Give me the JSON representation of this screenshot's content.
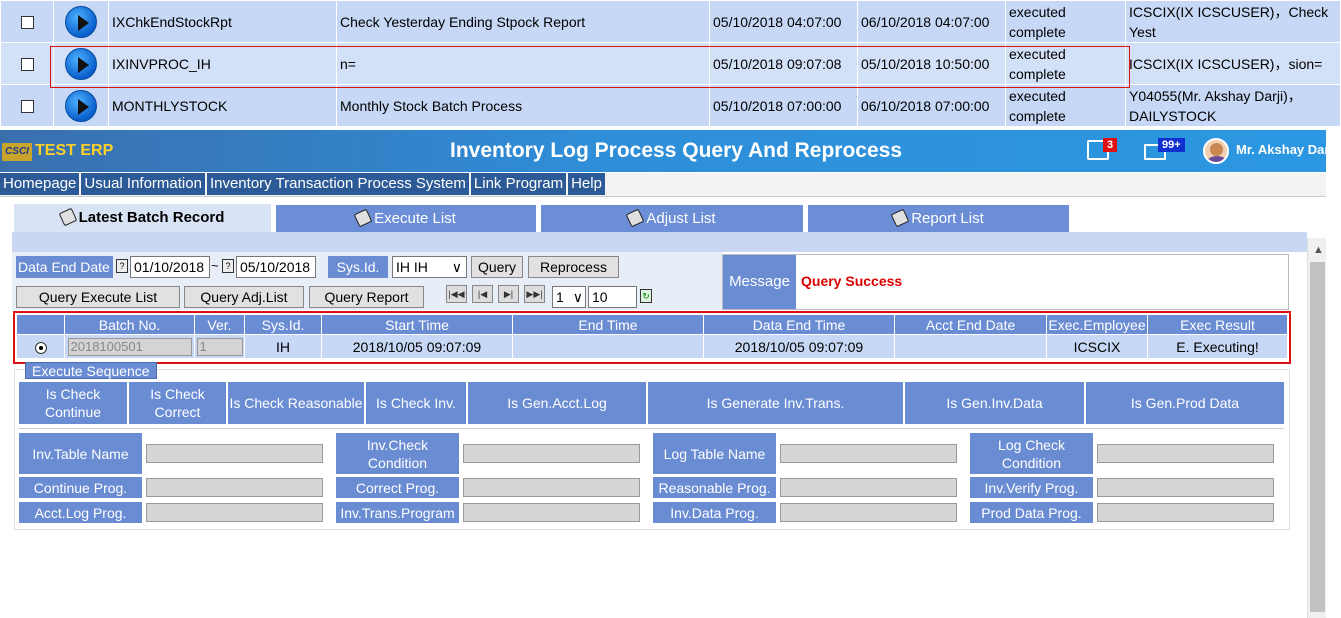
{
  "jobs": [
    {
      "name": "IXChkEndStockRpt",
      "desc": "Check Yesterday Ending Stpock Report",
      "start": "05/10/2018 04:07:00",
      "end": "06/10/2018 04:07:00",
      "status": "executed complete",
      "user": "ICSCIX(IX ICSCUSER)，Check Yest"
    },
    {
      "name": "IXINVPROC_IH",
      "desc": "n=",
      "start": "05/10/2018 09:07:08",
      "end": "05/10/2018 10:50:00",
      "status": "executed complete",
      "user": "ICSCIX(IX ICSCUSER)，sion="
    },
    {
      "name": "MONTHLYSTOCK",
      "desc": "Monthly Stock Batch Process",
      "start": "05/10/2018 07:00:00",
      "end": "06/10/2018 07:00:00",
      "status": "executed complete",
      "user": "Y04055(Mr. Akshay Darji)，DAILYSTOCK"
    }
  ],
  "header": {
    "logo": "CSCI",
    "app_name": "TEST ERP",
    "title": "Inventory Log Process Query And Reprocess",
    "notif_count": "3",
    "msg_count": "99+",
    "user": "Mr. Akshay Dar"
  },
  "menu": [
    "Homepage",
    "Usual Information",
    "Inventory Transaction Process System",
    "Link Program",
    "Help"
  ],
  "tabs": [
    "Latest Batch Record",
    "Execute List",
    "Adjust List",
    "Report List"
  ],
  "form": {
    "date_label": "Data End Date",
    "date_from": "01/10/2018",
    "tilde": "~",
    "date_to": "05/10/2018",
    "sysid_label": "Sys.Id.",
    "sysid_value": "IH IH",
    "query_btn": "Query",
    "reprocess_btn": "Reprocess",
    "query_exec_btn": "Query Execute List",
    "query_adj_btn": "Query Adj.List",
    "query_report_btn": "Query Report",
    "page_value": "1",
    "page_size": "10",
    "message_label": "Message",
    "message_text": "Query Success"
  },
  "batch": {
    "headers": [
      "",
      "Batch No.",
      "Ver.",
      "Sys.Id.",
      "Start Time",
      "End Time",
      "Data End Time",
      "Acct End Date",
      "Exec.Employee",
      "Exec Result"
    ],
    "row": {
      "batch_no": "2018100501",
      "ver": "1",
      "sys_id": "IH",
      "start": "2018/10/05 09:07:09",
      "end": "",
      "data_end": "2018/10/05 09:07:09",
      "acct_end": "",
      "employee": "ICSCIX",
      "result": "E. Executing!"
    }
  },
  "sequence": {
    "title": "Execute Sequence",
    "headers": [
      "Is Check Continue",
      "Is Check Correct",
      "Is Check Reasonable",
      "Is Check Inv.",
      "Is Gen.Acct.Log",
      "Is Generate Inv.Trans.",
      "Is Gen.Inv.Data",
      "Is Gen.Prod Data"
    ],
    "fields": [
      "Inv.Table Name",
      "Inv.Check Condition",
      "Log Table Name",
      "Log Check Condition",
      "Continue Prog.",
      "Correct Prog.",
      "Reasonable Prog.",
      "Inv.Verify Prog.",
      "Acct.Log Prog.",
      "Inv.Trans.Program",
      "Inv.Data Prog.",
      "Prod Data Prog."
    ]
  }
}
